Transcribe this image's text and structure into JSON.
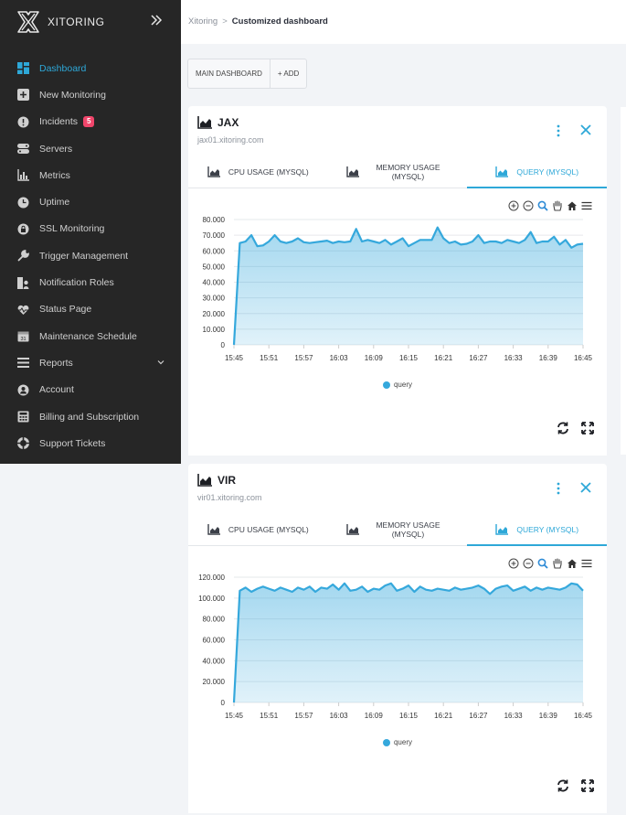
{
  "app": {
    "name": "XITORING"
  },
  "sidebar": {
    "items": [
      {
        "label": "Dashboard",
        "icon": "dashboard-icon",
        "active": true
      },
      {
        "label": "New Monitoring",
        "icon": "plus-icon"
      },
      {
        "label": "Incidents",
        "icon": "alert-icon",
        "badge": "5"
      },
      {
        "label": "Servers",
        "icon": "server-icon"
      },
      {
        "label": "Metrics",
        "icon": "metrics-icon"
      },
      {
        "label": "Uptime",
        "icon": "clock-icon"
      },
      {
        "label": "SSL Monitoring",
        "icon": "lock-icon"
      },
      {
        "label": "Trigger Management",
        "icon": "wrench-icon"
      },
      {
        "label": "Notification Roles",
        "icon": "person-icon"
      },
      {
        "label": "Status Page",
        "icon": "heartbeat-icon"
      },
      {
        "label": "Maintenance Schedule",
        "icon": "calendar-icon"
      },
      {
        "label": "Reports",
        "icon": "list-icon",
        "dropdown": true
      },
      {
        "label": "Account",
        "icon": "account-icon"
      },
      {
        "label": "Billing and Subscription",
        "icon": "calculator-icon"
      },
      {
        "label": "Support Tickets",
        "icon": "lifebuoy-icon"
      }
    ]
  },
  "breadcrumb": {
    "root": "Xitoring",
    "separator": ">",
    "current": "Customized dashboard"
  },
  "toolbar": {
    "main_dashboard": "MAIN DASHBOARD",
    "add": "+ ADD"
  },
  "cards": [
    {
      "title": "JAX",
      "subtitle": "jax01.xitoring.com",
      "tabs": [
        {
          "label": "CPU USAGE (MYSQL)"
        },
        {
          "label": "MEMORY USAGE (MYSQL)"
        },
        {
          "label": "QUERY (MYSQL)",
          "active": true
        }
      ]
    },
    {
      "title": "VIR",
      "subtitle": "vir01.xitoring.com",
      "tabs": [
        {
          "label": "CPU USAGE (MYSQL)"
        },
        {
          "label": "MEMORY USAGE (MYSQL)"
        },
        {
          "label": "QUERY (MYSQL)",
          "active": true
        }
      ]
    }
  ],
  "colors": {
    "accent": "#2ea8d8",
    "sidebar_bg": "#262626",
    "series": "#35a8dc",
    "badge": "#f0466b"
  },
  "chart_data": [
    {
      "type": "area",
      "x_ticks": [
        "15:45",
        "15:51",
        "15:57",
        "16:03",
        "16:09",
        "16:15",
        "16:21",
        "16:27",
        "16:33",
        "16:39",
        "16:45"
      ],
      "y_ticks": [
        "0",
        "10.000",
        "20.000",
        "30.000",
        "40.000",
        "50.000",
        "60.000",
        "70.000",
        "80.000"
      ],
      "ylim": [
        0,
        80000
      ],
      "xlim_minutes": [
        0,
        60
      ],
      "series": [
        {
          "name": "query",
          "points": [
            [
              0,
              0
            ],
            [
              1,
              65000
            ],
            [
              2,
              66000
            ],
            [
              3,
              70000
            ],
            [
              4,
              63000
            ],
            [
              5,
              63500
            ],
            [
              6,
              66000
            ],
            [
              7,
              70000
            ],
            [
              8,
              66000
            ],
            [
              9,
              65000
            ],
            [
              10,
              66000
            ],
            [
              11,
              68000
            ],
            [
              12,
              65500
            ],
            [
              13,
              65000
            ],
            [
              14,
              65500
            ],
            [
              15,
              66000
            ],
            [
              16,
              66500
            ],
            [
              17,
              65000
            ],
            [
              18,
              66000
            ],
            [
              19,
              65500
            ],
            [
              20,
              66000
            ],
            [
              21,
              74000
            ],
            [
              22,
              66000
            ],
            [
              23,
              67000
            ],
            [
              24,
              66000
            ],
            [
              25,
              65000
            ],
            [
              26,
              67000
            ],
            [
              27,
              64000
            ],
            [
              28,
              66000
            ],
            [
              29,
              68000
            ],
            [
              30,
              63000
            ],
            [
              31,
              65000
            ],
            [
              32,
              67000
            ],
            [
              33,
              67000
            ],
            [
              34,
              67000
            ],
            [
              35,
              75000
            ],
            [
              36,
              68000
            ],
            [
              37,
              65000
            ],
            [
              38,
              66000
            ],
            [
              39,
              64000
            ],
            [
              40,
              64500
            ],
            [
              41,
              66000
            ],
            [
              42,
              70000
            ],
            [
              43,
              65000
            ],
            [
              44,
              66000
            ],
            [
              45,
              66000
            ],
            [
              46,
              65000
            ],
            [
              47,
              67000
            ],
            [
              48,
              66000
            ],
            [
              49,
              65000
            ],
            [
              50,
              67000
            ],
            [
              51,
              72000
            ],
            [
              52,
              65000
            ],
            [
              53,
              66000
            ],
            [
              54,
              66000
            ],
            [
              55,
              69000
            ],
            [
              56,
              64000
            ],
            [
              57,
              67000
            ],
            [
              58,
              62000
            ],
            [
              59,
              64000
            ],
            [
              60,
              64500
            ]
          ]
        }
      ]
    },
    {
      "type": "area",
      "x_ticks": [
        "15:45",
        "15:51",
        "15:57",
        "16:03",
        "16:09",
        "16:15",
        "16:21",
        "16:27",
        "16:33",
        "16:39",
        "16:45"
      ],
      "y_ticks": [
        "0",
        "20.000",
        "40.000",
        "60.000",
        "80.000",
        "100.000",
        "120.000"
      ],
      "ylim": [
        0,
        120000
      ],
      "xlim_minutes": [
        0,
        60
      ],
      "series": [
        {
          "name": "query",
          "points": [
            [
              0,
              0
            ],
            [
              1,
              107000
            ],
            [
              2,
              110000
            ],
            [
              3,
              106000
            ],
            [
              4,
              109000
            ],
            [
              5,
              111000
            ],
            [
              6,
              109000
            ],
            [
              7,
              107000
            ],
            [
              8,
              110000
            ],
            [
              9,
              108000
            ],
            [
              10,
              106000
            ],
            [
              11,
              110000
            ],
            [
              12,
              108000
            ],
            [
              13,
              111000
            ],
            [
              14,
              106000
            ],
            [
              15,
              110000
            ],
            [
              16,
              109000
            ],
            [
              17,
              113000
            ],
            [
              18,
              108000
            ],
            [
              19,
              114000
            ],
            [
              20,
              107000
            ],
            [
              21,
              108000
            ],
            [
              22,
              111000
            ],
            [
              23,
              106000
            ],
            [
              24,
              109000
            ],
            [
              25,
              108000
            ],
            [
              26,
              112000
            ],
            [
              27,
              114000
            ],
            [
              28,
              107000
            ],
            [
              29,
              109000
            ],
            [
              30,
              112000
            ],
            [
              31,
              106000
            ],
            [
              32,
              111000
            ],
            [
              33,
              108000
            ],
            [
              34,
              107000
            ],
            [
              35,
              109000
            ],
            [
              36,
              108000
            ],
            [
              37,
              107000
            ],
            [
              38,
              110000
            ],
            [
              39,
              108000
            ],
            [
              40,
              109000
            ],
            [
              41,
              110000
            ],
            [
              42,
              112000
            ],
            [
              43,
              109000
            ],
            [
              44,
              104000
            ],
            [
              45,
              109000
            ],
            [
              46,
              111000
            ],
            [
              47,
              112000
            ],
            [
              48,
              107000
            ],
            [
              49,
              109000
            ],
            [
              50,
              111000
            ],
            [
              51,
              107000
            ],
            [
              52,
              110000
            ],
            [
              53,
              108000
            ],
            [
              54,
              110000
            ],
            [
              55,
              109000
            ],
            [
              56,
              108000
            ],
            [
              57,
              110000
            ],
            [
              58,
              114000
            ],
            [
              59,
              113000
            ],
            [
              60,
              107000
            ]
          ]
        }
      ]
    }
  ]
}
